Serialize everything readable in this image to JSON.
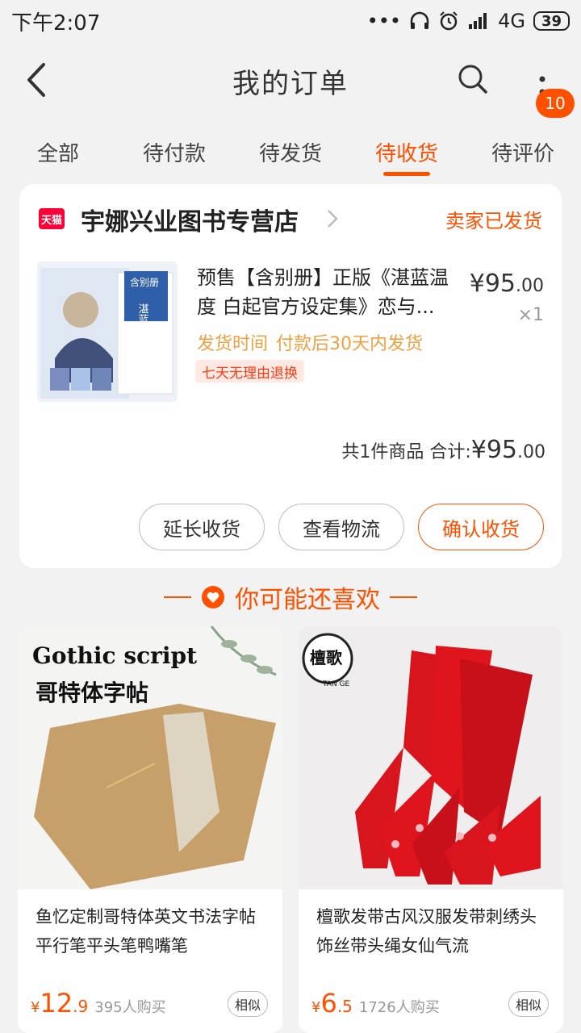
{
  "status_bar": {
    "time": "下午2:07",
    "signal_dots": "•••",
    "network": "4G",
    "battery": "39"
  },
  "header": {
    "title": "我的订单",
    "cart_badge": "10"
  },
  "tabs": [
    {
      "label": "全部"
    },
    {
      "label": "待付款"
    },
    {
      "label": "待发货"
    },
    {
      "label": "待收货"
    },
    {
      "label": "待评价"
    }
  ],
  "active_tab_index": 3,
  "order": {
    "store_logo": "天猫",
    "store_name": "宇娜兴业图书专营店",
    "status": "卖家已发货",
    "product_title": "预售【含别册】正版《湛蓝温度 白起官方设定集》恋与...",
    "price_int": "¥95",
    "price_dec": ".00",
    "qty": "×1",
    "ship_label": "发货时间",
    "ship_value": "付款后30天内发货",
    "return_tag": "七天无理由退换",
    "summary_count": "共1件商品 合计:",
    "summary_int": "¥95",
    "summary_dec": ".00",
    "thumb_caption": "湛蓝温度",
    "thumb_badge": "含别册"
  },
  "actions": {
    "extend": "延长收货",
    "logistics": "查看物流",
    "confirm": "确认收货"
  },
  "recommend": {
    "title": "你可能还喜欢",
    "items": [
      {
        "image_text_en": "Gothic script",
        "image_text_cn": "哥特体字帖",
        "title": "鱼忆定制哥特体英文书法字帖平行笔平头笔鸭嘴笔",
        "currency": "¥",
        "price_int": "12",
        "price_dec": ".9",
        "sold": "395人购买",
        "similar": "相似"
      },
      {
        "image_text_cn": "檀歌",
        "image_text_en": "TAN GE",
        "title": "檀歌发带古风汉服发带刺绣头饰丝带头绳女仙气流",
        "currency": "¥",
        "price_int": "6",
        "price_dec": ".5",
        "sold": "1726人购买",
        "similar": "相似"
      }
    ]
  },
  "colors": {
    "accent": "#ff5000",
    "tmall": "#ff0036"
  }
}
